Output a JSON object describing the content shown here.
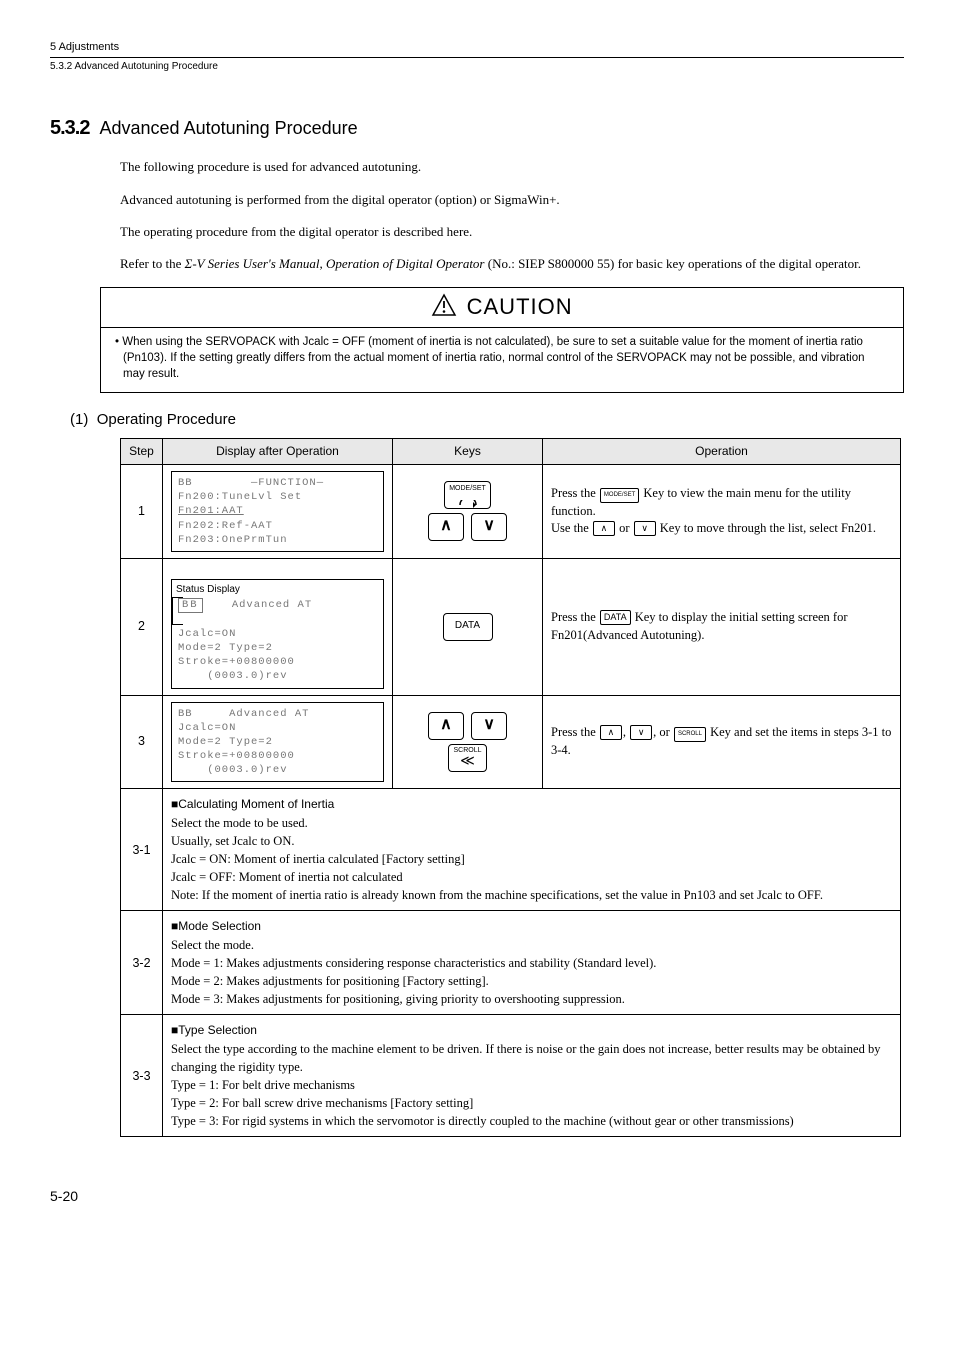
{
  "header": {
    "chapter": "5  Adjustments",
    "sub": "5.3.2  Advanced Autotuning Procedure"
  },
  "section": {
    "num": "5.3.2",
    "title": "Advanced Autotuning Procedure"
  },
  "intro": {
    "p1": "The following procedure is used for advanced autotuning.",
    "p2": "Advanced autotuning is performed from the digital operator (option) or SigmaWin+.",
    "p3": "The operating procedure from the digital operator is described here.",
    "p4a": "Refer to the ",
    "p4i": "Σ-V Series User's Manual, Operation of Digital Operator",
    "p4b": " (No.: SIEP S800000 55) for basic key operations of the digital operator."
  },
  "caution": {
    "label": "CAUTION",
    "body": "• When using the SERVOPACK with Jcalc = OFF (moment of inertia is not calculated), be sure to set a suitable value for the moment of inertia ratio (Pn103). If the setting greatly differs from the actual moment of inertia ratio, normal control of the SERVOPACK may not be possible, and vibration may result."
  },
  "subhead": {
    "num": "(1)",
    "title": "Operating Procedure"
  },
  "table": {
    "headers": {
      "step": "Step",
      "disp": "Display after Operation",
      "keys": "Keys",
      "op": "Operation"
    },
    "rows": [
      {
        "step": "1",
        "lcd": "BB        ―FUNCTION―\nFn200:TuneLvl Set\nFn201:AAT\nFn202:Ref-AAT\nFn203:OnePrmTun",
        "lcd_hl_line": 2,
        "op_a": "Press the ",
        "op_b": " Key to view the main menu for the utility function.",
        "op_c": "Use the ",
        "op_d": " or ",
        "op_e": " Key to move through the list, select Fn201.",
        "key1": "MODE/SET",
        "key2": "∧",
        "key3": "∨",
        "inl1": "MODE/SET",
        "inl2": "∧",
        "inl3": "∨"
      },
      {
        "step": "2",
        "status_label": "Status Display",
        "lcd_bb": "BB",
        "lcd_tail": "    Advanced AT",
        "lcd_rest": "Jcalc=ON\nMode=2 Type=2\nStroke=+00800000\n    (0003.0)rev",
        "op_a": "Press the ",
        "op_b": " Key to display the initial setting screen for Fn201(Advanced Autotuning).",
        "key1": "DATA",
        "inl1": "DATA"
      },
      {
        "step": "3",
        "lcd": "BB     Advanced AT\nJcalc=ON\nMode=2 Type=2\nStroke=+00800000\n    (0003.0)rev",
        "op_a": "Press the ",
        "op_b": ", ",
        "op_c": ", or ",
        "op_d": " Key and set the items in steps 3-1 to 3-4.",
        "key1": "∧",
        "key2": "∨",
        "key3": "SCROLL",
        "inl1": "∧",
        "inl2": "∨",
        "inl3": "SCROLL"
      }
    ],
    "note31": {
      "step": "3-1",
      "h": "■Calculating Moment of Inertia",
      "l1": "Select the mode to be used.",
      "l2": "Usually, set Jcalc to ON.",
      "l3": "Jcalc = ON: Moment of inertia calculated [Factory setting]",
      "l4": "Jcalc = OFF: Moment of inertia not calculated",
      "l5": "Note: If the moment of inertia ratio is already known from the machine specifications, set the value in Pn103 and set Jcalc to OFF."
    },
    "note32": {
      "step": "3-2",
      "h": "■Mode Selection",
      "l1": "Select the mode.",
      "l2": "Mode = 1: Makes adjustments considering response characteristics and stability (Standard level).",
      "l3": "Mode = 2: Makes adjustments for positioning [Factory setting].",
      "l4": "Mode = 3: Makes adjustments for positioning, giving priority to overshooting suppression."
    },
    "note33": {
      "step": "3-3",
      "h": "■Type Selection",
      "l1": "Select the type according to the machine element to be driven. If there is noise or the gain does not increase, better results may be obtained by changing the rigidity type.",
      "l2": "Type = 1: For belt drive mechanisms",
      "l3": "Type = 2: For ball screw drive mechanisms [Factory setting]",
      "l4": "Type = 3: For rigid systems in which the servomotor is directly coupled to the machine (without gear or other transmissions)"
    }
  },
  "page": "5-20"
}
